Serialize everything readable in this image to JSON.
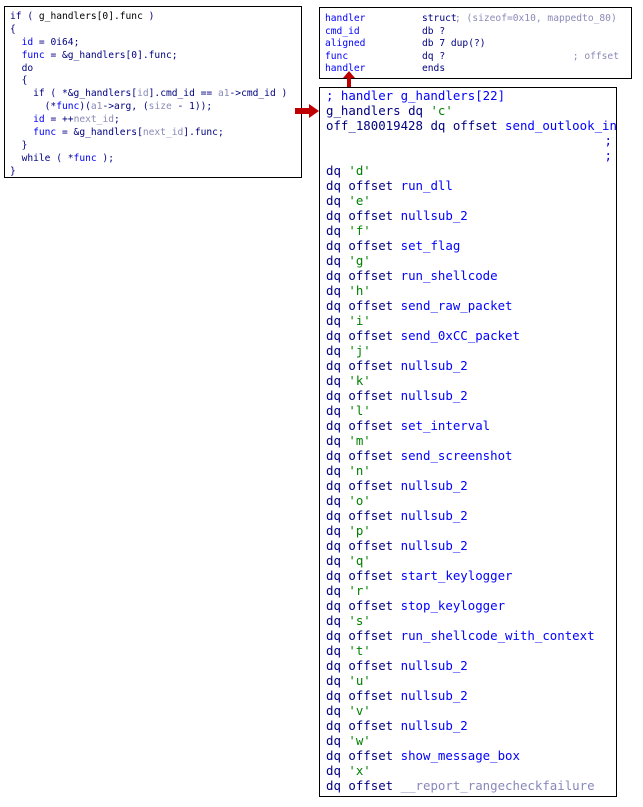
{
  "code": {
    "l1": [
      "if ( ",
      "g_handlers[0].func",
      " )"
    ],
    "l2": "{",
    "l3": [
      "id",
      " = ",
      "0i64",
      ";"
    ],
    "l4": [
      "func",
      " = &g_handlers[0].func;"
    ],
    "l5": "do",
    "l6": "{",
    "l7": [
      "if ( *&g_handlers[",
      "id",
      "].cmd_id == ",
      "a1",
      "->cmd_id )"
    ],
    "l8": [
      "(*",
      "func",
      ")(",
      "a1",
      "->arg, (",
      "size",
      " - 1));"
    ],
    "l9": [
      "id",
      " = ++",
      "next_id",
      ";"
    ],
    "l10": [
      "func",
      " = &g_handlers[",
      "next_id",
      "].func;"
    ],
    "l11": "}",
    "l12": [
      "while ( *",
      "func",
      " );"
    ],
    "l13": "}"
  },
  "struct": {
    "rows": [
      {
        "name": "handler",
        "type": "struct",
        "extra": "; (sizeof=0x10, mappedto_80)",
        "right": ""
      },
      {
        "name": "cmd_id",
        "type": "db ?",
        "extra": "",
        "right": ""
      },
      {
        "name": "aligned",
        "type": "db 7 dup(?)",
        "extra": "",
        "right": ""
      },
      {
        "name": "func",
        "type": "dq ?",
        "extra": "",
        "right": "; offset"
      },
      {
        "name": "handler",
        "type": "ends",
        "extra": "",
        "right": ""
      }
    ]
  },
  "data": {
    "header1": "; handler g_handlers[22]",
    "header2": [
      "g_handlers",
      " dq ",
      "'c'"
    ],
    "header3": [
      "off_180019428",
      " dq offset ",
      "send_outlook_info"
    ],
    "semi1": ";",
    "semi2": ";",
    "dq": "dq",
    "dq_offset": "dq offset",
    "entries": [
      {
        "char": "'d'",
        "func": "run_dll"
      },
      {
        "char": "'e'",
        "func": "nullsub_2"
      },
      {
        "char": "'f'",
        "func": "set_flag"
      },
      {
        "char": "'g'",
        "func": "run_shellcode"
      },
      {
        "char": "'h'",
        "func": "send_raw_packet"
      },
      {
        "char": "'i'",
        "func": "send_0xCC_packet"
      },
      {
        "char": "'j'",
        "func": "nullsub_2"
      },
      {
        "char": "'k'",
        "func": "nullsub_2"
      },
      {
        "char": "'l'",
        "func": "set_interval"
      },
      {
        "char": "'m'",
        "func": "send_screenshot"
      },
      {
        "char": "'n'",
        "func": "nullsub_2"
      },
      {
        "char": "'o'",
        "func": "nullsub_2"
      },
      {
        "char": "'p'",
        "func": "nullsub_2"
      },
      {
        "char": "'q'",
        "func": "start_keylogger"
      },
      {
        "char": "'r'",
        "func": "stop_keylogger"
      },
      {
        "char": "'s'",
        "func": "run_shellcode_with_context"
      },
      {
        "char": "'t'",
        "func": "nullsub_2"
      },
      {
        "char": "'u'",
        "func": "nullsub_2"
      },
      {
        "char": "'v'",
        "func": "nullsub_2"
      },
      {
        "char": "'w'",
        "func": "show_message_box"
      },
      {
        "char": "'x'",
        "func": "__report_rangecheckfailure",
        "gray": true
      }
    ]
  },
  "colors": {
    "arrow": "#c00000",
    "keyword": "#000080",
    "identifier": "#0000ff",
    "char_literal": "#008000"
  }
}
